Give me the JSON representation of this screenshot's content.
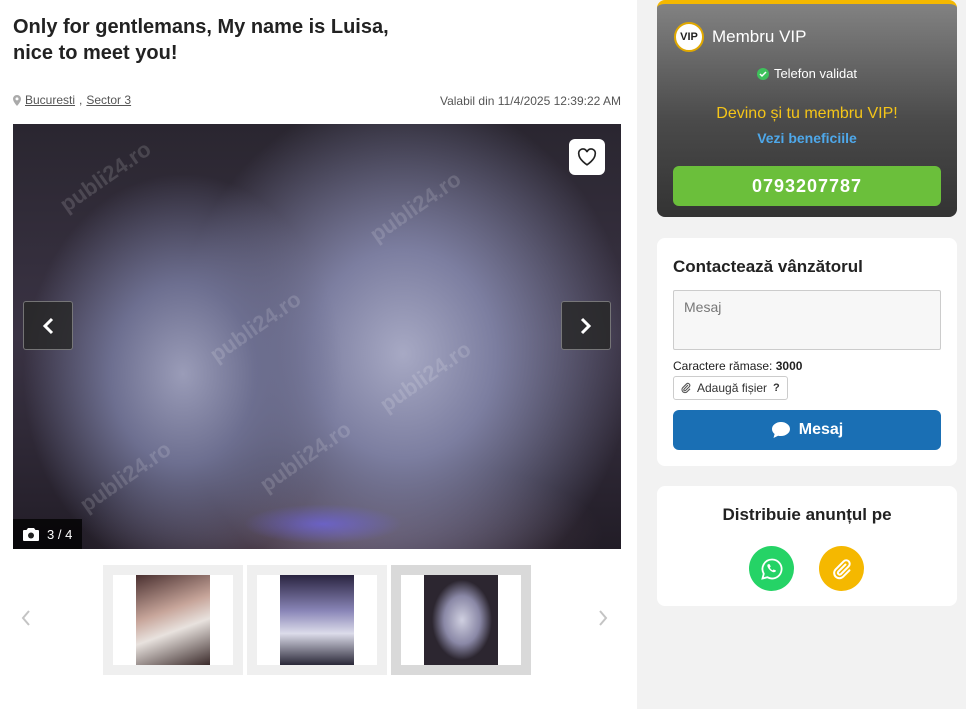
{
  "listing": {
    "title": "Only for gentlemans, My name is Luisa, nice to meet you!",
    "city": "Bucuresti",
    "sector": "Sector 3",
    "valid_from": "Valabil din 11/4/2025 12:39:22 AM"
  },
  "gallery": {
    "counter": "3 / 4",
    "watermark": "publi24.ro",
    "thumbnails": [
      "photo 1",
      "photo 2",
      "photo 3"
    ],
    "active_thumbnail": 3
  },
  "vip": {
    "badge": "VIP",
    "title": "Membru VIP",
    "phone_status": "Telefon validat",
    "become": "Devino și tu membru VIP!",
    "benefits": "Vezi beneficiile",
    "phone": "0793207787"
  },
  "contact": {
    "title": "Contactează vânzătorul",
    "message_placeholder": "Mesaj",
    "chars_label": "Caractere rămase:",
    "chars_remaining": "3000",
    "attach_label": "Adaugă fișier",
    "attach_help": "?",
    "send_label": "Mesaj"
  },
  "share": {
    "title": "Distribuie anunțul pe"
  },
  "colors": {
    "vip_accent": "#f5b800",
    "phone_button": "#6bbf3b",
    "message_button": "#1a6fb4",
    "whatsapp": "#25d366",
    "copy_link": "#f5b800",
    "benefits_link": "#4ea8ea"
  }
}
